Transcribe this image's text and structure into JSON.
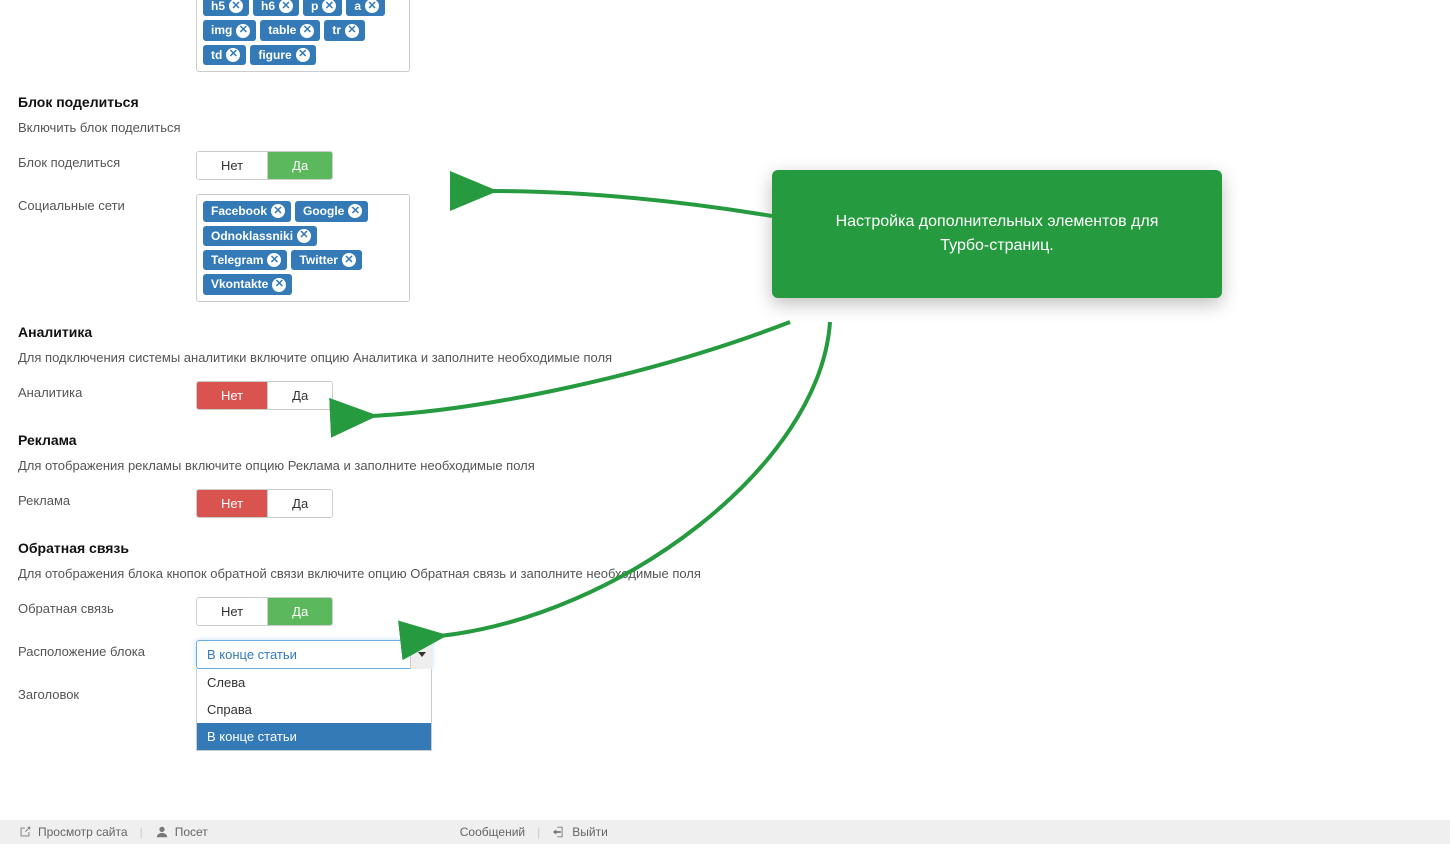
{
  "tags_row1": [
    "h5",
    "h6",
    "p",
    "a"
  ],
  "tags_row2": [
    "img",
    "table",
    "tr"
  ],
  "tags_row3": [
    "td",
    "figure"
  ],
  "share": {
    "title": "Блок поделиться",
    "desc": "Включить блок поделиться",
    "label": "Блок поделиться",
    "no": "Нет",
    "yes": "Да",
    "socials_label": "Социальные сети",
    "socials": [
      "Facebook",
      "Google",
      "Odnoklassniki",
      "Telegram",
      "Twitter",
      "Vkontakte"
    ]
  },
  "analytics": {
    "title": "Аналитика",
    "desc": "Для подключения системы аналитики включите опцию Аналитика и заполните необходимые поля",
    "label": "Аналитика",
    "no": "Нет",
    "yes": "Да"
  },
  "ads": {
    "title": "Реклама",
    "desc": "Для отображения рекламы включите опцию Реклама и заполните необходимые поля",
    "label": "Реклама",
    "no": "Нет",
    "yes": "Да"
  },
  "feedback": {
    "title": "Обратная связь",
    "desc": "Для отображения блока кнопок обратной связи включите опцию Обратная связь и заполните необходимые поля",
    "label": "Обратная связь",
    "no": "Нет",
    "yes": "Да",
    "placement_label": "Расположение блока",
    "placement_value": "В конце статьи",
    "options": [
      "Слева",
      "Справа",
      "В конце статьи"
    ],
    "heading_label": "Заголовок"
  },
  "callout": {
    "line1": "Настройка дополнительных элементов для",
    "line2": "Турбо-страниц."
  },
  "footer": {
    "preview": "Просмотр сайта",
    "visitors_prefix": "Посет",
    "messages": "Сообщений",
    "logout": "Выйти"
  }
}
